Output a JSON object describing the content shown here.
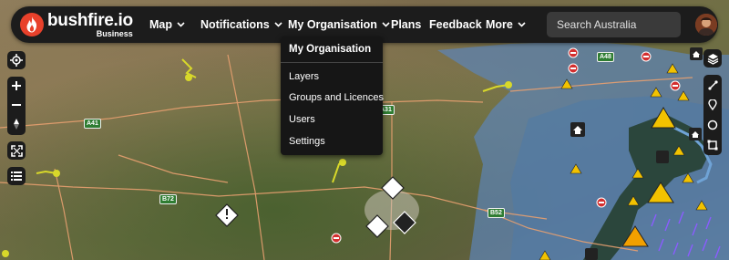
{
  "app": {
    "logo_name": "bushfire.io",
    "logo_sub": "Business"
  },
  "nav": {
    "map": "Map",
    "notifications": "Notifications",
    "my_organisation": "My Organisation",
    "plans": "Plans",
    "feedback": "Feedback",
    "more": "More"
  },
  "search": {
    "placeholder": "Search Australia"
  },
  "dropdown": {
    "title": "My Organisation",
    "items": [
      "Layers",
      "Groups and Licences",
      "Users",
      "Settings"
    ]
  },
  "map": {
    "road_labels": [
      "A41",
      "A48",
      "A31",
      "B72",
      "B52"
    ]
  },
  "colors": {
    "topbar": "#1c1c1c",
    "brand": "#e8412b",
    "water_zone": "#5c85b8",
    "warning_yellow": "#f2c200",
    "no_entry_red": "#d32f2f",
    "lightning_yellow": "#d8d82a",
    "rain_purple": "#8a5cff"
  },
  "icons": {
    "logo": "flame-icon",
    "locate": "crosshair-icon",
    "zoom_in": "plus-icon",
    "zoom_out": "minus-icon",
    "compass": "compass-arrow-icon",
    "fullscreen": "expand-icon",
    "list": "list-icon",
    "layers": "layers-icon",
    "draw_line": "line-draw-icon",
    "draw_point": "map-pin-icon",
    "draw_circle": "circle-draw-icon",
    "draw_square": "square-draw-icon"
  }
}
